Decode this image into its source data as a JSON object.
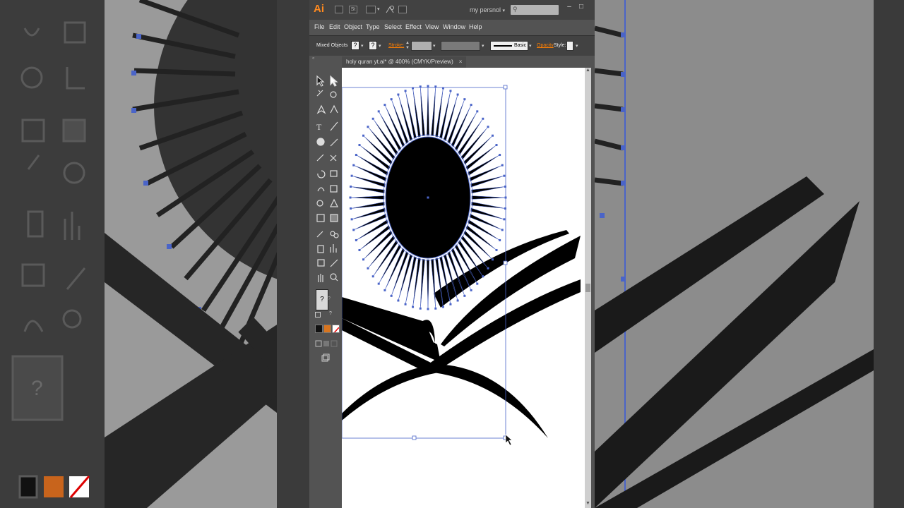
{
  "app": {
    "logo": "Ai",
    "icon_labels": [
      "",
      "St"
    ],
    "workspace": "my persnol",
    "workspace_chevron": "▾",
    "search_icon": "⚲",
    "minimize": "–",
    "restore": "□"
  },
  "menu": [
    "File",
    "Edit",
    "Object",
    "Type",
    "Select",
    "Effect",
    "View",
    "Window",
    "Help"
  ],
  "control_bar": {
    "selection_label": "Mixed Objects",
    "fill_value": "?",
    "stroke_value": "?",
    "stroke_label": "Stroke:",
    "stroke_style": "Basic",
    "opacity_label": "Opacity",
    "style_label": "Style:",
    "label_color": "#ff7f00"
  },
  "tools": {
    "unknown_fill": "?",
    "icons": [
      "selection-tool",
      "direct-selection-tool",
      "magic-wand-tool",
      "lasso-tool",
      "pen-tool",
      "curvature-tool",
      "type-tool",
      "line-tool",
      "ellipse-tool",
      "paintbrush-tool",
      "pencil-tool",
      "scissors-tool",
      "rotate-tool",
      "scale-tool",
      "warp-tool",
      "free-transform-tool",
      "shape-builder-tool",
      "perspective-grid-tool",
      "mesh-tool",
      "gradient-tool",
      "eyedropper-tool",
      "blend-tool",
      "symbol-sprayer-tool",
      "column-graph-tool",
      "artboard-tool",
      "slice-tool",
      "hand-tool",
      "zoom-tool"
    ]
  },
  "document": {
    "tab_title": "holy quran yt.ai* @ 400% (CMYK/Preview)",
    "close": "×"
  },
  "colors": {
    "selection": "#4a64c8",
    "accent": "#ff8a1f",
    "artwork": "#000000"
  }
}
